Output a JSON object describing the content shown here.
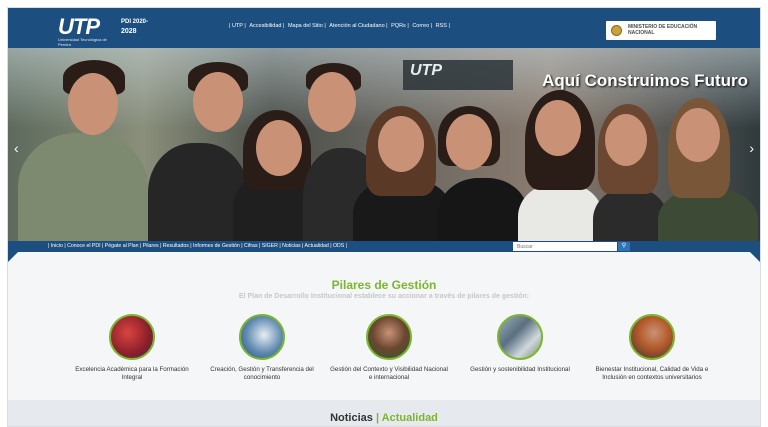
{
  "header": {
    "logo_text": "UTP",
    "logo_subtext": "Universidad Tecnológica de Pereira",
    "pdi_line1": "PDI 2020-",
    "pdi_line2": "2028",
    "top_links": [
      "| UTP |",
      "Accesibilidad |",
      "Mapa del Sitio |",
      "Atención al Ciudadano |",
      "PQRs |",
      "Correo |",
      "RSS |"
    ],
    "ministerio_text": "MINISTERIO DE EDUCACIÓN NACIONAL"
  },
  "hero": {
    "slogan": "Aquí Construimos Futuro",
    "sign_text": "UTP",
    "prev_icon": "chevron-left-icon",
    "next_icon": "chevron-right-icon"
  },
  "nav": {
    "links_text": "| Inicio | Conoce el PDI | Pégate al Plan | Pilares | Resultados | Informes de Gestión | Cifras | SIGER | Noticias | Actualidad | ODS |",
    "search_placeholder": "Buscar",
    "search_icon": "search-icon"
  },
  "pilares": {
    "title": "Pilares de Gestión",
    "subtitle": "El Plan de Desarrollo Institucional establece su accionar a través de pilares de gestión:",
    "items": [
      {
        "label": "Excelencia Académica para la Formación Integral"
      },
      {
        "label": "Creación, Gestión y Transferencia del conocimiento"
      },
      {
        "label": "Gestión del Contexto y Visibilidad Nacional e internacional"
      },
      {
        "label": "Gestión y sostenibilidad Institucional"
      },
      {
        "label": "Bienestar Institucional, Calidad de Vida e Inclusión en contextos universitarios"
      }
    ]
  },
  "news": {
    "title_a": "Noticias",
    "separator": "|",
    "title_b": "Actualidad"
  },
  "colors": {
    "brand_blue": "#1c4f80",
    "accent_green": "#7cb52f"
  }
}
